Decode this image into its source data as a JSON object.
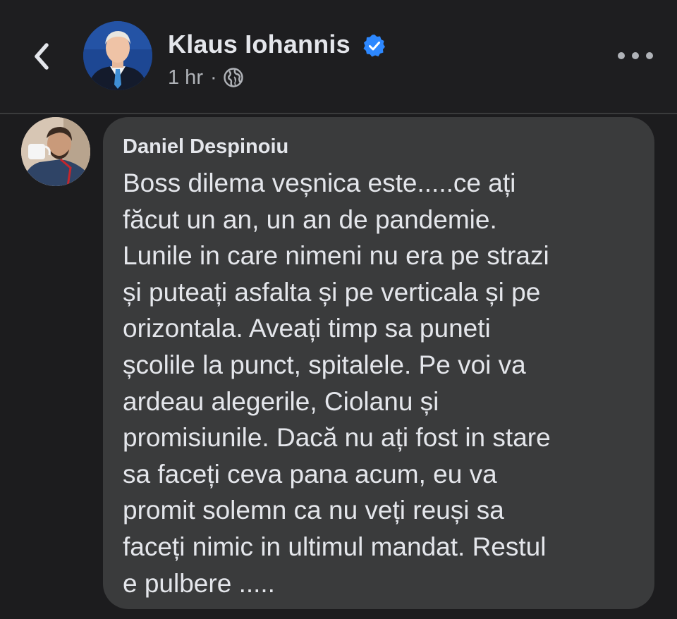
{
  "post": {
    "author": "Klaus Iohannis",
    "verified": true,
    "time": "1 hr",
    "separator": "·",
    "audience_icon": "globe-icon"
  },
  "comment": {
    "author": "Daniel Despinoiu",
    "text": "Boss dilema veșnica este.....ce ați\nfăcut un an, un an de pandemie.\nLunile in care nimeni nu era pe strazi\nși puteați asfalta și pe verticala și pe\norizontala. Aveați timp sa puneti\nșcolile la punct, spitalele. Pe voi va\nardeau alegerile, Ciolanu și\npromisiunile. Dacă nu ați fost in stare\nsa faceți ceva pana acum, eu va\npromit solemn ca nu veți reuși sa\nfaceți nimic in ultimul mandat. Restul\ne pulbere ....."
  },
  "icons": {
    "back": "chevron-left-icon",
    "more": "more-horizontal-icon",
    "verified": "verified-badge-icon",
    "audience": "globe-icon"
  },
  "colors": {
    "background": "#1c1c1e",
    "bubble": "#3a3b3c",
    "primary_text": "#e4e6eb",
    "secondary_text": "#b0b3b8",
    "verified_blue": "#2d88ff"
  }
}
